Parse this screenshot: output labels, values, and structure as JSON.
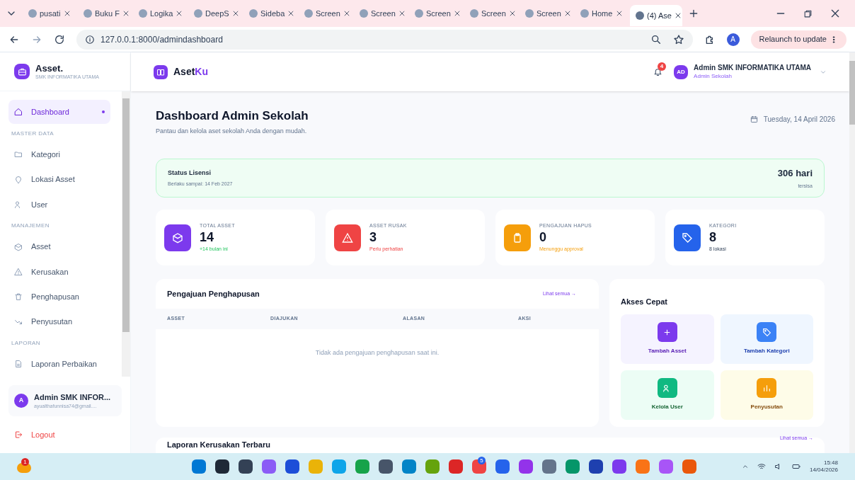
{
  "browser": {
    "tabs": [
      {
        "label": "pusati",
        "selected": false
      },
      {
        "label": "Buku F",
        "selected": false
      },
      {
        "label": "Logika",
        "selected": false
      },
      {
        "label": "DeepS",
        "selected": false
      },
      {
        "label": "Sideba",
        "selected": false
      },
      {
        "label": "Screen",
        "selected": false
      },
      {
        "label": "Screen",
        "selected": false
      },
      {
        "label": "Screen",
        "selected": false
      },
      {
        "label": "Screen",
        "selected": false
      },
      {
        "label": "Screen",
        "selected": false
      },
      {
        "label": "Home",
        "selected": false
      },
      {
        "label": "(4) Ase",
        "selected": true
      }
    ],
    "url": "127.0.0.1:8000/admindashboard",
    "relaunch": "Relaunch to update",
    "profile": "A"
  },
  "sidebar": {
    "brand": "Asset.",
    "school": "SMK INFORMATIKA UTAMA",
    "nav": [
      {
        "kind": "item",
        "label": "Dashboard",
        "selected": true
      },
      {
        "kind": "section",
        "label": "MASTER DATA"
      },
      {
        "kind": "item",
        "label": "Kategori",
        "selected": false
      },
      {
        "kind": "item",
        "label": "Lokasi Asset",
        "selected": false
      },
      {
        "kind": "item",
        "label": "User",
        "selected": false
      },
      {
        "kind": "section",
        "label": "MANAJEMEN"
      },
      {
        "kind": "item",
        "label": "Asset",
        "selected": false
      },
      {
        "kind": "item",
        "label": "Kerusakan",
        "selected": false
      },
      {
        "kind": "item",
        "label": "Penghapusan",
        "selected": false
      },
      {
        "kind": "item",
        "label": "Penyusutan",
        "selected": false
      },
      {
        "kind": "section",
        "label": "LAPORAN"
      },
      {
        "kind": "item",
        "label": "Laporan Perbaikan",
        "selected": false
      }
    ],
    "user": {
      "initial": "A",
      "name": "Admin SMK INFOR...",
      "email": "ayualthafunnisa74@gmail...."
    },
    "logout": "Logout"
  },
  "topbar": {
    "app_name": "Aset",
    "app_name_accent": "Ku",
    "notifications": "4",
    "avatar": "AD",
    "user_name": "Admin SMK INFORMATIKA UTAMA",
    "role": "Admin Sekolah"
  },
  "page": {
    "title": "Dashboard Admin Sekolah",
    "subtitle": "Pantau dan kelola aset sekolah Anda dengan mudah.",
    "date": "Tuesday, 14 April 2026"
  },
  "license": {
    "title": "Status Lisensi",
    "valid_until": "Berlaku sampai: 14 Feb 2027",
    "days": "306 hari",
    "days_label": "tersisa"
  },
  "stats": [
    {
      "label": "TOTAL ASSET",
      "value": "14",
      "note": "+14 bulan ini",
      "color": "#7c3aed"
    },
    {
      "label": "ASSET RUSAK",
      "value": "3",
      "note": "Perlu perhatian",
      "color": "#ef4444"
    },
    {
      "label": "PENGAJUAN HAPUS",
      "value": "0",
      "note": "Menunggu approval",
      "color": "#f59e0b"
    },
    {
      "label": "KATEGORI",
      "value": "8",
      "note": "8 lokasi",
      "color": "#2563eb"
    }
  ],
  "deletion_requests": {
    "title": "Pengajuan Penghapusan",
    "link": "Lihat semua →",
    "columns": [
      "ASSET",
      "DIAJUKAN",
      "ALASAN",
      "AKSI"
    ],
    "empty": "Tidak ada pengajuan penghapusan saat ini."
  },
  "quick_access": {
    "title": "Akses Cepat",
    "items": [
      {
        "label": "Tambah Asset",
        "color": "#7c3aed"
      },
      {
        "label": "Tambah Kategori",
        "color": "#3b82f6"
      },
      {
        "label": "Kelola User",
        "color": "#10b981"
      },
      {
        "label": "Penyusutan",
        "color": "#f59e0b"
      }
    ]
  },
  "damage_reports": {
    "title": "Laporan Kerusakan Terbaru",
    "link": "Lihat semua →"
  },
  "taskbar": {
    "weather_badge": "1",
    "app_badge": "5",
    "time": "15:48",
    "date": "14/04/2026"
  }
}
